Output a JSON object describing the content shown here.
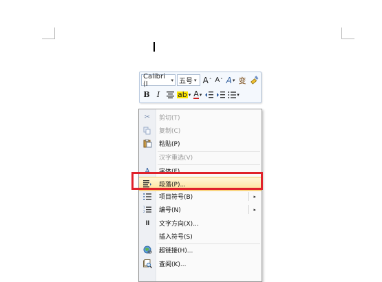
{
  "mini_toolbar": {
    "font_name": "Calibri (I",
    "font_size": "五号",
    "grow_font": "A",
    "shrink_font": "A",
    "styles_glyph": "A",
    "phonetic_glyph": "变",
    "bold": "B",
    "italic": "I",
    "font_color_glyph": "A"
  },
  "context_menu": {
    "items": [
      {
        "label": "剪切(T)",
        "icon": "scissors-icon",
        "disabled": true
      },
      {
        "label": "复制(C)",
        "icon": "copy-icon",
        "disabled": true
      },
      {
        "label": "粘贴(P)",
        "icon": "paste-icon",
        "disabled": false
      },
      {
        "label": "汉字重选(V)",
        "icon": "",
        "disabled": true
      },
      {
        "label": "字体(F)...",
        "icon": "font-icon",
        "disabled": false
      },
      {
        "label": "段落(P)...",
        "icon": "paragraph-icon",
        "disabled": false,
        "highlighted": true
      },
      {
        "label": "项目符号(B)",
        "icon": "bullets-icon",
        "disabled": false,
        "submenu": true
      },
      {
        "label": "编号(N)",
        "icon": "numbering-icon",
        "disabled": false,
        "submenu": true
      },
      {
        "label": "文字方向(X)...",
        "icon": "text-direction-icon",
        "disabled": false
      },
      {
        "label": "插入符号(S)",
        "icon": "",
        "disabled": false
      },
      {
        "label": "超链接(H)...",
        "icon": "hyperlink-icon",
        "disabled": false
      },
      {
        "label": "查阅(K)...",
        "icon": "lookup-icon",
        "disabled": false
      }
    ],
    "highlight_color": "#e0222b"
  }
}
